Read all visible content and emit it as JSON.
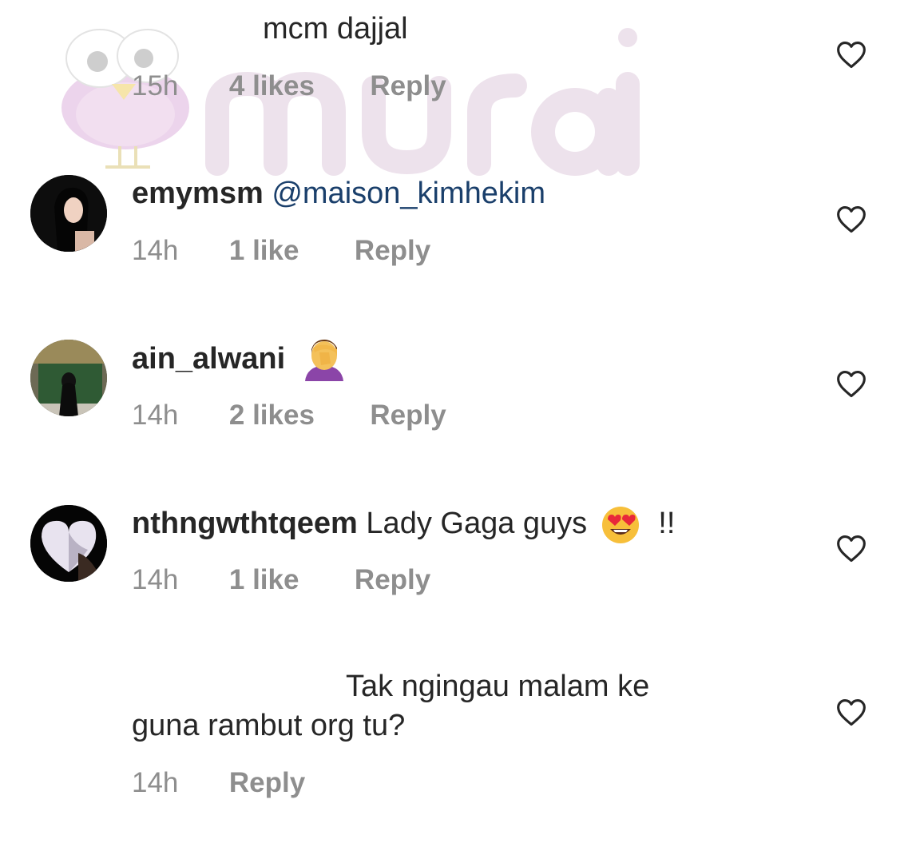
{
  "comments": [
    {
      "text": "mcm dajjal",
      "time": "15h",
      "likes": "4 likes",
      "reply": "Reply"
    },
    {
      "username": "emymsm",
      "mention": "@maison_kimhekim",
      "time": "14h",
      "likes": "1 like",
      "reply": "Reply"
    },
    {
      "username": "ain_alwani",
      "emoji_icon": "face-palm-icon",
      "time": "14h",
      "likes": "2 likes",
      "reply": "Reply"
    },
    {
      "username": "nthngwthtqeem",
      "text_before": "Lady Gaga guys",
      "emoji_icon": "heart-eyes-icon",
      "text_after": "!!",
      "time": "14h",
      "likes": "1 like",
      "reply": "Reply"
    },
    {
      "text_line1": "Tak ngingau malam ke",
      "text_line2": "guna rambut org tu?",
      "time": "14h",
      "reply": "Reply"
    }
  ],
  "watermark": {
    "logo_text": "murai"
  },
  "colors": {
    "text": "#262626",
    "meta": "#8e8e8e",
    "mention": "#1a3f6b",
    "watermark_pink": "#e8cde6",
    "watermark_text": "#eadfe8"
  },
  "icons": [
    "heart-outline-icon"
  ]
}
